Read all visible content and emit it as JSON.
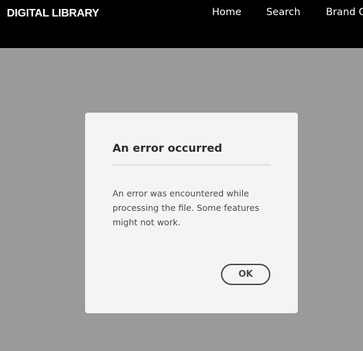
{
  "header": {
    "brand": "DIGITAL LIBRARY",
    "nav": {
      "home": "Home",
      "search": "Search",
      "brand_guidelines": "Brand G"
    }
  },
  "dialog": {
    "title": "An error occurred",
    "message": "An error was encountered while processing the file. Some features might not work.",
    "ok_label": "OK"
  },
  "colors": {
    "header_bg": "#000000",
    "overlay_bg": "#9a9a9a",
    "dialog_bg": "#f4f4f4",
    "text_dark": "#2c2c2c",
    "text_body": "#4b4b4b"
  }
}
